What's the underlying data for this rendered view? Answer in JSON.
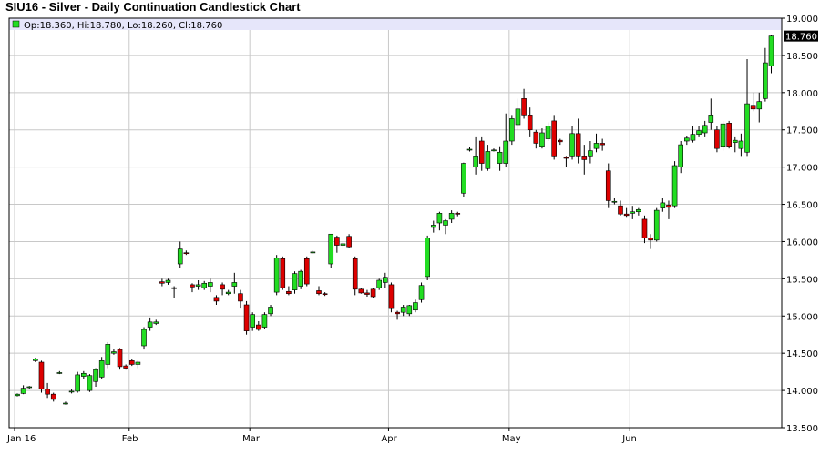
{
  "header": {
    "title": "SIU16 - Silver - Daily Continuation Candlestick Chart",
    "legend_text": "Op:18.360, Hi:18.780, Lo:18.260, Cl:18.760"
  },
  "colors": {
    "up": "#22dd22",
    "down": "#dd0000",
    "legend_band": "#e6e6fa",
    "grid": "#c8c8c8",
    "last_label_bg": "#000000"
  },
  "chart_data": {
    "type": "candlestick",
    "title": "SIU16 - Silver - Daily Continuation Candlestick Chart",
    "ylim": [
      13.5,
      19.0
    ],
    "y_ticks": [
      "13.500",
      "14.000",
      "14.500",
      "15.000",
      "15.500",
      "16.000",
      "16.500",
      "17.000",
      "17.500",
      "18.000",
      "18.500",
      "19.000"
    ],
    "x_tick_labels": [
      "Jan 16",
      "Feb",
      "Mar",
      "Apr",
      "May",
      "Jun"
    ],
    "x_tick_index": [
      0,
      19,
      39,
      62,
      82,
      102
    ],
    "grid": true,
    "last_value_label": "18.760",
    "ohlc": [
      [
        13.93,
        13.96,
        13.92,
        13.95
      ],
      [
        13.96,
        14.07,
        13.95,
        14.03
      ],
      [
        14.04,
        14.06,
        14.02,
        14.05
      ],
      [
        14.4,
        14.44,
        14.38,
        14.42
      ],
      [
        14.38,
        14.4,
        13.97,
        14.02
      ],
      [
        14.02,
        14.1,
        13.9,
        13.95
      ],
      [
        13.95,
        13.97,
        13.85,
        13.88
      ],
      [
        14.24,
        14.26,
        14.22,
        14.24
      ],
      [
        13.83,
        13.85,
        13.81,
        13.83
      ],
      [
        13.98,
        14.02,
        13.96,
        13.99
      ],
      [
        13.99,
        14.25,
        13.97,
        14.21
      ],
      [
        14.19,
        14.26,
        14.15,
        14.23
      ],
      [
        14.0,
        14.22,
        13.98,
        14.2
      ],
      [
        14.12,
        14.3,
        14.05,
        14.28
      ],
      [
        14.18,
        14.45,
        14.15,
        14.4
      ],
      [
        14.35,
        14.65,
        14.3,
        14.62
      ],
      [
        14.5,
        14.56,
        14.48,
        14.52
      ],
      [
        14.55,
        14.57,
        14.28,
        14.32
      ],
      [
        14.33,
        14.35,
        14.28,
        14.3
      ],
      [
        14.4,
        14.42,
        14.33,
        14.35
      ],
      [
        14.35,
        14.4,
        14.3,
        14.38
      ],
      [
        14.6,
        14.85,
        14.55,
        14.82
      ],
      [
        14.85,
        14.98,
        14.8,
        14.92
      ],
      [
        14.9,
        14.95,
        14.88,
        14.92
      ],
      [
        15.46,
        15.5,
        15.4,
        15.44
      ],
      [
        15.45,
        15.5,
        15.42,
        15.48
      ],
      [
        15.38,
        15.4,
        15.24,
        15.37
      ],
      [
        15.7,
        16.0,
        15.65,
        15.9
      ],
      [
        15.85,
        15.88,
        15.82,
        15.84
      ],
      [
        15.42,
        15.44,
        15.32,
        15.39
      ],
      [
        15.4,
        15.48,
        15.35,
        15.42
      ],
      [
        15.38,
        15.47,
        15.35,
        15.44
      ],
      [
        15.4,
        15.5,
        15.32,
        15.45
      ],
      [
        15.25,
        15.28,
        15.15,
        15.2
      ],
      [
        15.42,
        15.45,
        15.28,
        15.36
      ],
      [
        15.3,
        15.35,
        15.28,
        15.32
      ],
      [
        15.4,
        15.58,
        15.3,
        15.45
      ],
      [
        15.3,
        15.35,
        15.1,
        15.2
      ],
      [
        15.15,
        15.2,
        14.75,
        14.8
      ],
      [
        14.85,
        15.05,
        14.8,
        15.02
      ],
      [
        14.88,
        14.93,
        14.8,
        14.82
      ],
      [
        14.85,
        15.05,
        14.82,
        15.02
      ],
      [
        15.03,
        15.15,
        15.0,
        15.12
      ],
      [
        15.32,
        15.82,
        15.28,
        15.78
      ],
      [
        15.77,
        15.8,
        15.35,
        15.38
      ],
      [
        15.33,
        15.4,
        15.28,
        15.3
      ],
      [
        15.35,
        15.6,
        15.3,
        15.57
      ],
      [
        15.4,
        15.62,
        15.36,
        15.6
      ],
      [
        15.77,
        15.8,
        15.4,
        15.43
      ],
      [
        15.86,
        15.88,
        15.84,
        15.86
      ],
      [
        15.34,
        15.4,
        15.28,
        15.3
      ],
      [
        15.3,
        15.32,
        15.27,
        15.29
      ],
      [
        15.7,
        16.1,
        15.65,
        16.1
      ],
      [
        16.06,
        16.08,
        15.85,
        15.95
      ],
      [
        15.95,
        16.0,
        15.9,
        15.97
      ],
      [
        16.07,
        16.1,
        15.92,
        15.93
      ],
      [
        15.77,
        15.8,
        15.28,
        15.36
      ],
      [
        15.36,
        15.38,
        15.3,
        15.31
      ],
      [
        15.31,
        15.35,
        15.26,
        15.29
      ],
      [
        15.36,
        15.38,
        15.24,
        15.26
      ],
      [
        15.38,
        15.5,
        15.35,
        15.48
      ],
      [
        15.45,
        15.58,
        15.38,
        15.52
      ],
      [
        15.42,
        15.45,
        15.05,
        15.1
      ],
      [
        15.05,
        15.07,
        14.95,
        15.03
      ],
      [
        15.05,
        15.15,
        15.0,
        15.12
      ],
      [
        15.03,
        15.15,
        15.0,
        15.14
      ],
      [
        15.08,
        15.22,
        15.05,
        15.18
      ],
      [
        15.22,
        15.45,
        15.18,
        15.41
      ],
      [
        15.53,
        16.08,
        15.48,
        16.05
      ],
      [
        16.19,
        16.28,
        16.12,
        16.22
      ],
      [
        16.25,
        16.4,
        16.15,
        16.38
      ],
      [
        16.22,
        16.3,
        16.1,
        16.28
      ],
      [
        16.3,
        16.42,
        16.25,
        16.38
      ],
      [
        16.38,
        16.4,
        16.34,
        16.37
      ],
      [
        16.65,
        17.06,
        16.6,
        17.05
      ],
      [
        17.24,
        17.27,
        17.21,
        17.24
      ],
      [
        17.0,
        17.4,
        16.9,
        17.15
      ],
      [
        17.35,
        17.4,
        16.95,
        17.05
      ],
      [
        16.98,
        17.3,
        16.95,
        17.21
      ],
      [
        17.23,
        17.25,
        17.21,
        17.23
      ],
      [
        17.05,
        17.28,
        16.95,
        17.2
      ],
      [
        17.05,
        17.72,
        17.0,
        17.35
      ],
      [
        17.35,
        17.7,
        17.3,
        17.65
      ],
      [
        17.57,
        17.92,
        17.5,
        17.78
      ],
      [
        17.92,
        18.05,
        17.65,
        17.7
      ],
      [
        17.7,
        17.8,
        17.4,
        17.5
      ],
      [
        17.47,
        17.5,
        17.25,
        17.32
      ],
      [
        17.28,
        17.52,
        17.25,
        17.46
      ],
      [
        17.38,
        17.6,
        17.35,
        17.55
      ],
      [
        17.62,
        17.7,
        17.1,
        17.15
      ],
      [
        17.36,
        17.38,
        17.3,
        17.34
      ],
      [
        17.13,
        17.15,
        17.0,
        17.12
      ],
      [
        17.15,
        17.55,
        17.1,
        17.45
      ],
      [
        17.45,
        17.65,
        17.05,
        17.15
      ],
      [
        17.15,
        17.3,
        16.9,
        17.1
      ],
      [
        17.15,
        17.35,
        17.05,
        17.22
      ],
      [
        17.25,
        17.45,
        17.2,
        17.32
      ],
      [
        17.32,
        17.38,
        17.22,
        17.3
      ],
      [
        16.95,
        17.05,
        16.45,
        16.55
      ],
      [
        16.54,
        16.58,
        16.5,
        16.54
      ],
      [
        16.48,
        16.55,
        16.35,
        16.37
      ],
      [
        16.37,
        16.45,
        16.32,
        16.35
      ],
      [
        16.38,
        16.48,
        16.3,
        16.4
      ],
      [
        16.4,
        16.45,
        16.35,
        16.43
      ],
      [
        16.3,
        16.35,
        15.98,
        16.05
      ],
      [
        16.05,
        16.1,
        15.9,
        16.02
      ],
      [
        16.02,
        16.45,
        16.0,
        16.42
      ],
      [
        16.45,
        16.58,
        16.4,
        16.52
      ],
      [
        16.49,
        16.55,
        16.3,
        16.46
      ],
      [
        16.48,
        17.08,
        16.45,
        17.02
      ],
      [
        17.0,
        17.35,
        16.92,
        17.3
      ],
      [
        17.35,
        17.42,
        17.3,
        17.39
      ],
      [
        17.36,
        17.55,
        17.33,
        17.44
      ],
      [
        17.44,
        17.55,
        17.4,
        17.49
      ],
      [
        17.46,
        17.62,
        17.4,
        17.56
      ],
      [
        17.6,
        17.92,
        17.5,
        17.7
      ],
      [
        17.5,
        17.55,
        17.2,
        17.25
      ],
      [
        17.28,
        17.62,
        17.22,
        17.58
      ],
      [
        17.59,
        17.62,
        17.25,
        17.28
      ],
      [
        17.33,
        17.4,
        17.2,
        17.36
      ],
      [
        17.25,
        17.45,
        17.15,
        17.35
      ],
      [
        17.2,
        18.45,
        17.15,
        17.85
      ],
      [
        17.83,
        18.0,
        17.75,
        17.78
      ],
      [
        17.78,
        18.0,
        17.6,
        17.88
      ],
      [
        17.92,
        18.6,
        17.88,
        18.4
      ],
      [
        18.36,
        18.78,
        18.26,
        18.76
      ]
    ]
  }
}
